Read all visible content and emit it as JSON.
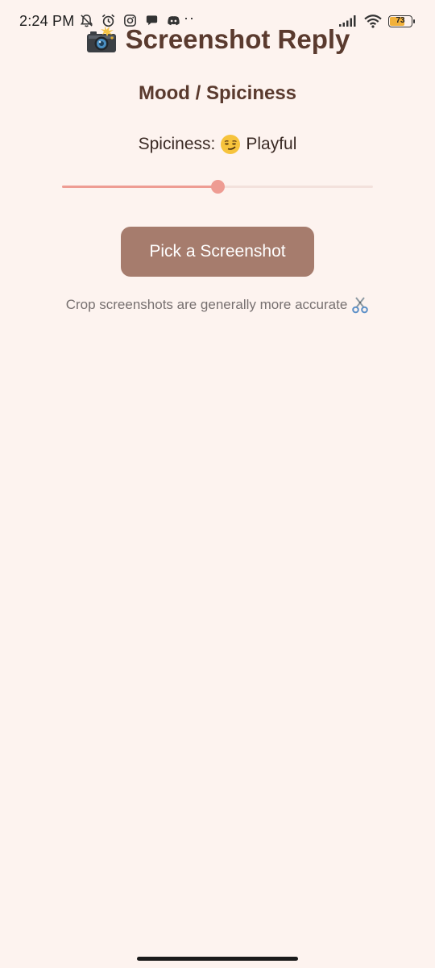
{
  "status_bar": {
    "time": "2:24 PM",
    "left_icons": [
      "bell-off-icon",
      "alarm-icon",
      "instagram-icon",
      "chat-bubble-icon",
      "discord-icon"
    ],
    "overflow": "··",
    "battery_level": "73",
    "battery_fraction": 0.73,
    "battery_color": "#f2b13a"
  },
  "header": {
    "icon": "camera-flash-icon",
    "title": "Screenshot Reply"
  },
  "section": {
    "heading": "Mood / Spiciness"
  },
  "spiciness": {
    "label": "Spiciness:",
    "emoji": "smirk-emoji-icon",
    "value_label": "Playful",
    "slider_value": 0.5
  },
  "actions": {
    "pick_label": "Pick a Screenshot"
  },
  "hint": {
    "text": "Crop screenshots are generally more accurate",
    "icon": "scissors-icon"
  },
  "colors": {
    "background": "#fdf3ef",
    "title": "#5a3a2e",
    "button": "#a67c6d",
    "slider_active": "#ee9c93",
    "slider_inactive": "#f3e1dc",
    "hint": "#777070"
  }
}
